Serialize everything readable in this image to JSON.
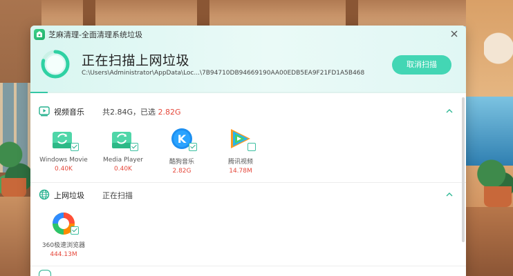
{
  "window": {
    "title": "芝麻清理-全面清理系统垃圾",
    "close_icon": "close-icon"
  },
  "scan": {
    "heading": "正在扫描上网垃圾",
    "path": "C:\\Users\\Administrator\\AppData\\Loc...\\7B94710DB94669190AA00EDB5EA9F21FD1A5B468",
    "cancel_label": "取消扫描",
    "progress": 0.04
  },
  "sections": {
    "video": {
      "name": "视频音乐",
      "stat_prefix": "共2.84G，已选 ",
      "stat_selected": "2.82G",
      "icon": "video-music-icon",
      "items": [
        {
          "name": "Windows Movie",
          "size": "0.40K",
          "icon": "recycle-icon",
          "checked": true
        },
        {
          "name": "Media Player",
          "size": "0.40K",
          "icon": "recycle-icon",
          "checked": true
        },
        {
          "name": "酷狗音乐",
          "size": "2.82G",
          "icon": "kugou-icon",
          "checked": true
        },
        {
          "name": "腾讯视频",
          "size": "14.78M",
          "icon": "tencent-video-icon",
          "checked": false
        }
      ]
    },
    "web": {
      "name": "上网垃圾",
      "stat": "正在扫描",
      "icon": "globe-icon",
      "items": [
        {
          "name": "360极速浏览器",
          "size": "444.13M",
          "icon": "360-browser-icon",
          "checked": true
        }
      ]
    }
  },
  "colors": {
    "accent": "#43d6b4",
    "red": "#e5473a"
  }
}
